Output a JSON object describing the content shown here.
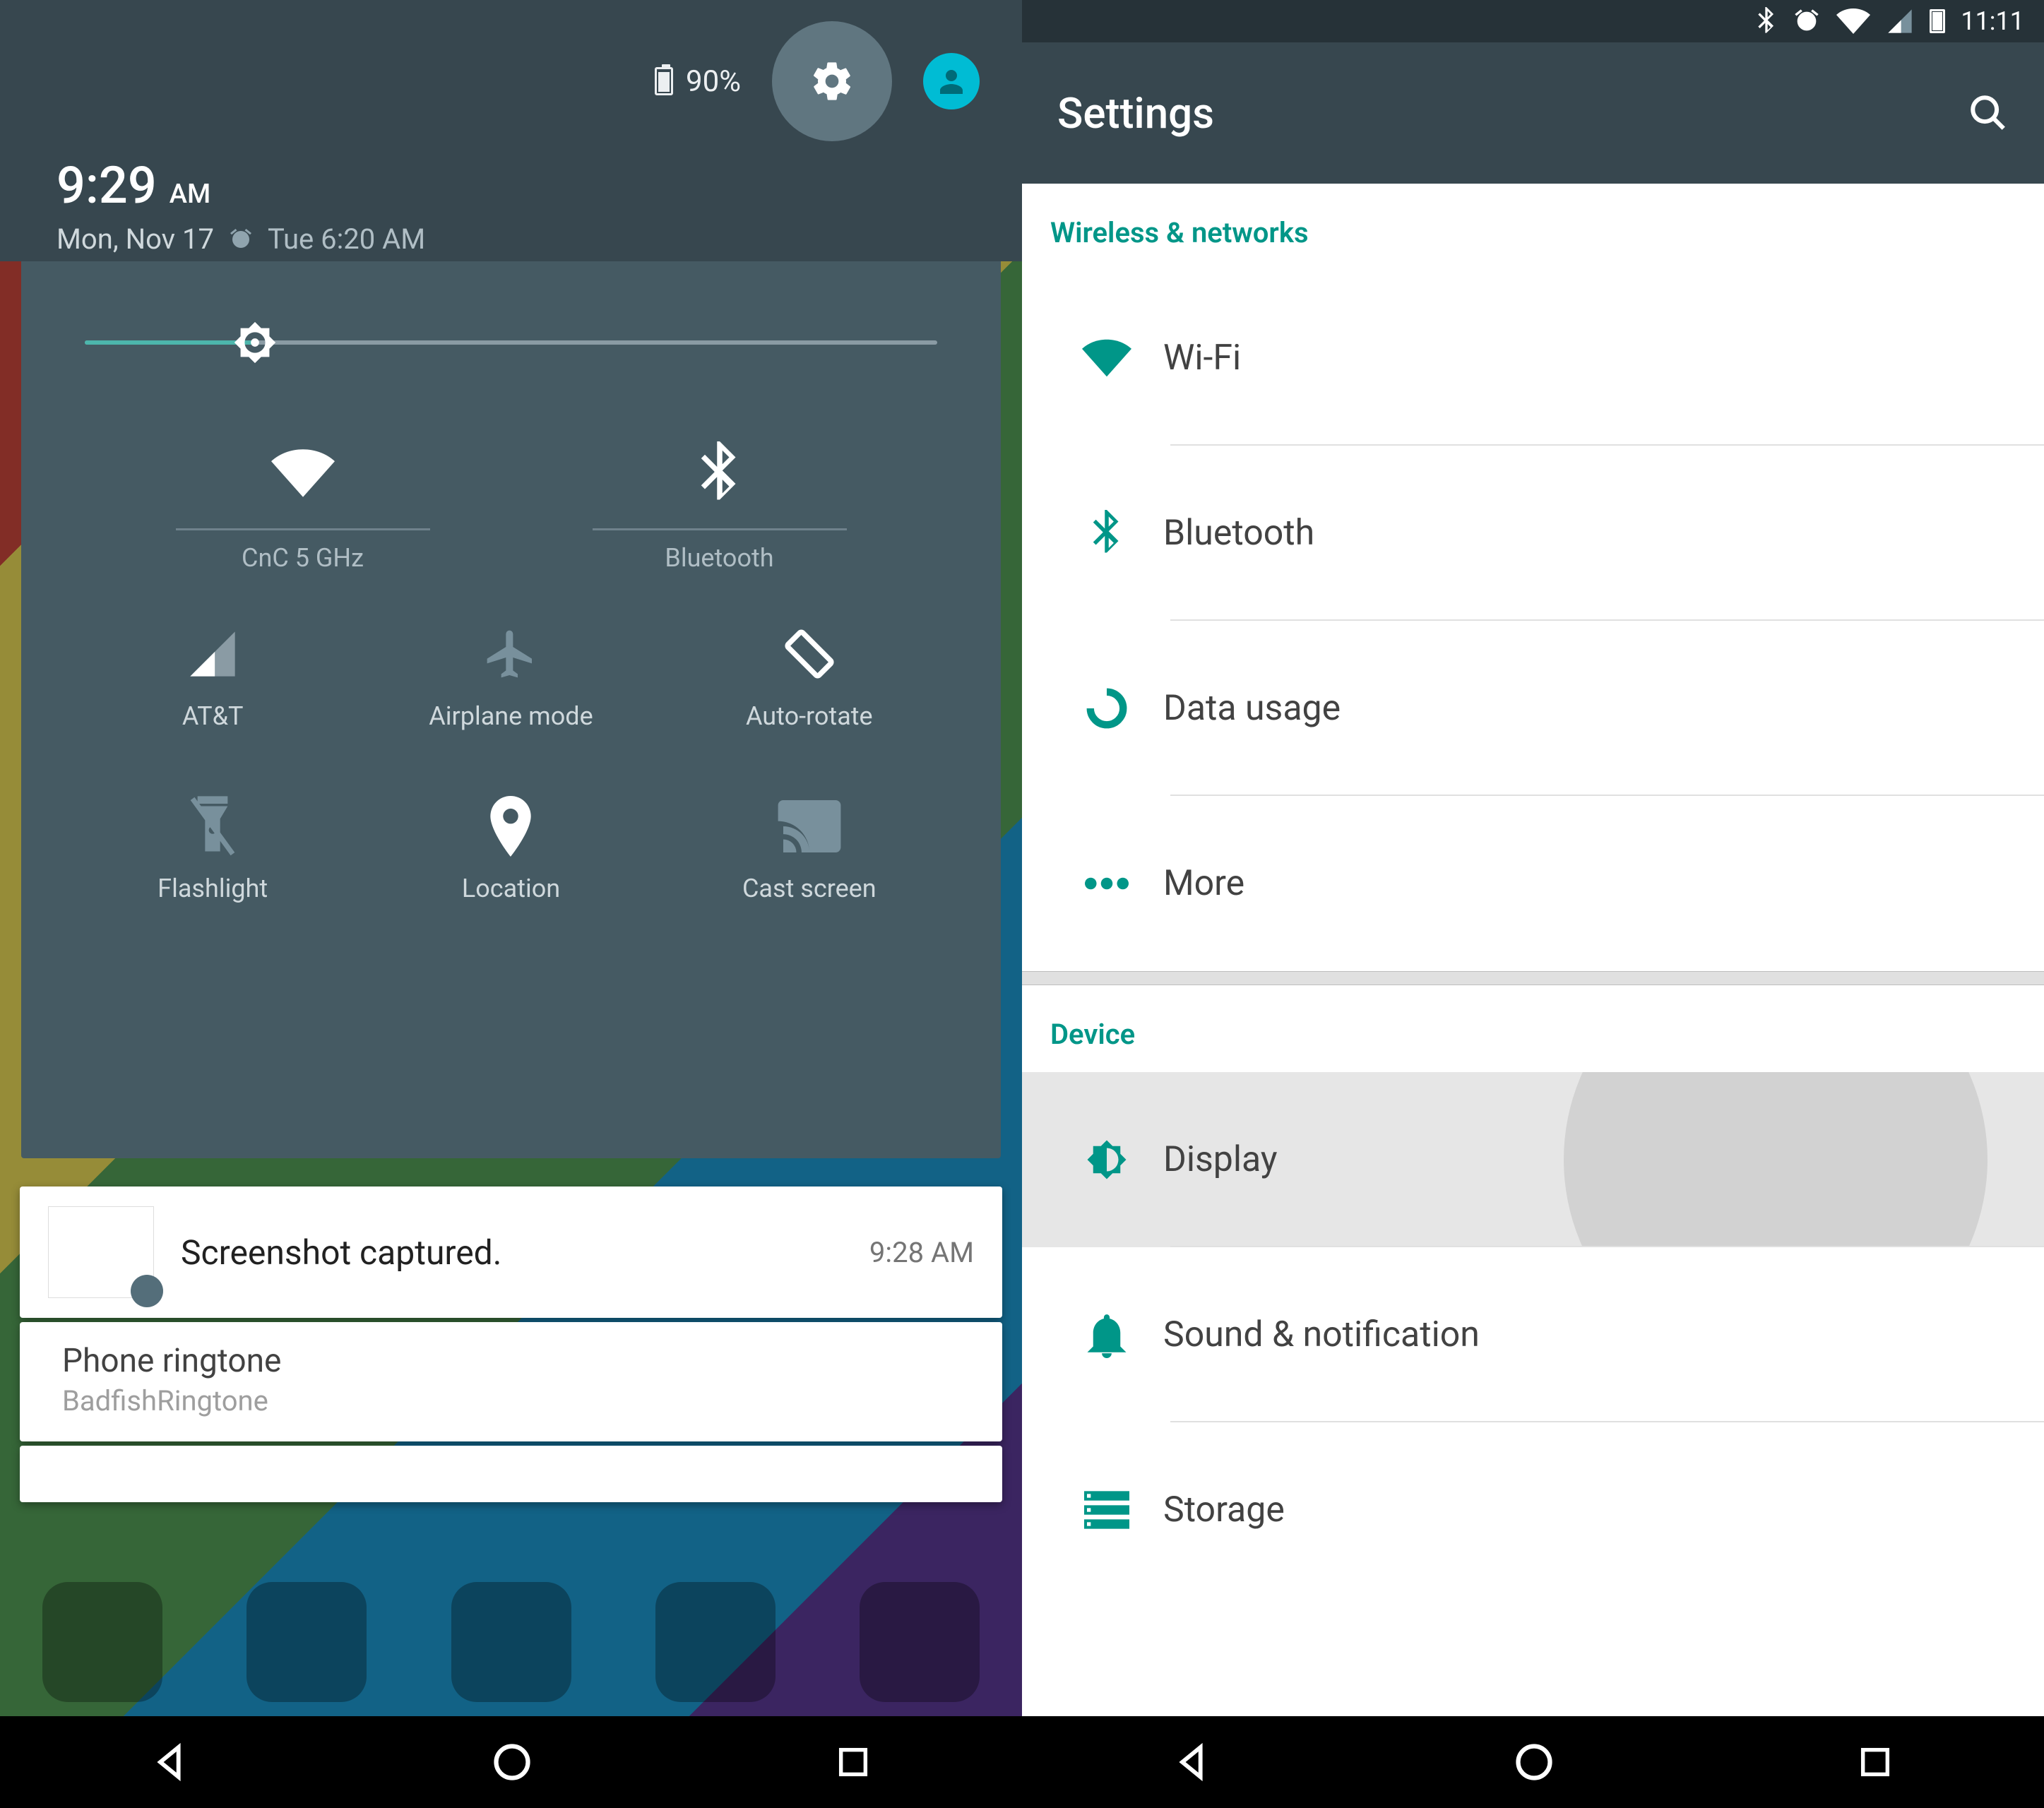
{
  "left": {
    "battery_pct": "90%",
    "clock_time": "9:29",
    "clock_ampm": "AM",
    "date": "Mon, Nov 17",
    "alarm": "Tue 6:20 AM",
    "tiles_top": [
      {
        "label": "CnC 5 GHz",
        "icon": "wifi-icon"
      },
      {
        "label": "Bluetooth",
        "icon": "bluetooth-icon"
      }
    ],
    "tiles": [
      {
        "label": "AT&T",
        "icon": "signal-icon"
      },
      {
        "label": "Airplane mode",
        "icon": "airplane-icon"
      },
      {
        "label": "Auto-rotate",
        "icon": "rotate-icon"
      },
      {
        "label": "Flashlight",
        "icon": "flashlight-icon"
      },
      {
        "label": "Location",
        "icon": "location-icon"
      },
      {
        "label": "Cast screen",
        "icon": "cast-icon"
      }
    ],
    "brightness_pct": 20,
    "notifications": {
      "screenshot": {
        "title": "Screenshot captured.",
        "time": "9:28 AM"
      },
      "ringtone": {
        "title": "Phone ringtone",
        "sub": "BadfishRingtone"
      }
    }
  },
  "right": {
    "status_time": "11:11",
    "app_title": "Settings",
    "section1": "Wireless & networks",
    "section2": "Device",
    "items1": [
      {
        "label": "Wi-Fi"
      },
      {
        "label": "Bluetooth"
      },
      {
        "label": "Data usage"
      },
      {
        "label": "More"
      }
    ],
    "items2": [
      {
        "label": "Display"
      },
      {
        "label": "Sound & notification"
      },
      {
        "label": "Storage"
      }
    ]
  }
}
